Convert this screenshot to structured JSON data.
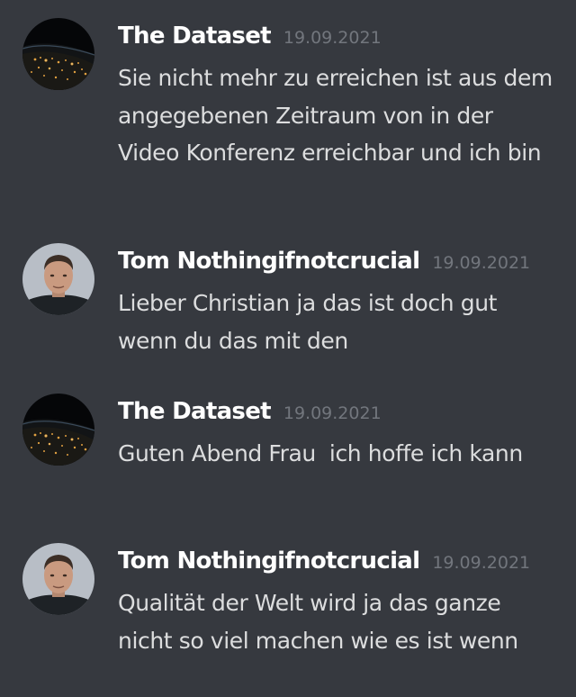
{
  "colors": {
    "background": "#36393f",
    "author": "#ffffff",
    "timestamp": "#72767d",
    "text": "#dcddde"
  },
  "messages": [
    {
      "author": "The Dataset",
      "timestamp": "19.09.2021",
      "avatar_icon": "earth-night-avatar-icon",
      "text": "Sie nicht mehr zu erreichen ist aus dem angegebenen Zeitraum von in der Video Konferenz erreichbar und ich bin"
    },
    {
      "author": "Tom Nothingifnotcrucial",
      "timestamp": "19.09.2021",
      "avatar_icon": "person-portrait-avatar-icon",
      "text": "Lieber Christian ja das ist doch gut wenn du das mit den"
    },
    {
      "author": "The Dataset",
      "timestamp": "19.09.2021",
      "avatar_icon": "earth-night-avatar-icon",
      "text": "Guten Abend Frau  ich hoffe ich kann"
    },
    {
      "author": "Tom Nothingifnotcrucial",
      "timestamp": "19.09.2021",
      "avatar_icon": "person-portrait-avatar-icon",
      "text": "Qualität der Welt wird ja das ganze nicht so viel machen wie es ist wenn"
    }
  ]
}
